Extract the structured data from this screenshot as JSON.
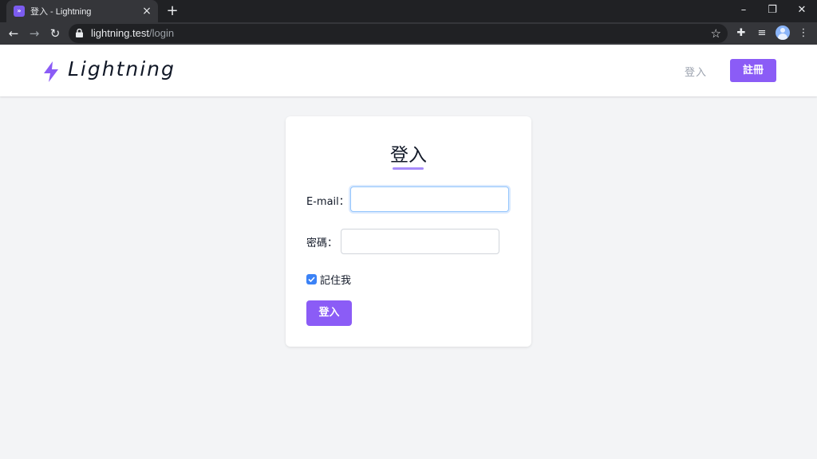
{
  "browser": {
    "tab_title": "登入 - Lightning",
    "favicon_text": "»",
    "url_host": "lightning.test",
    "url_path": "/login",
    "icons": [
      "back-icon",
      "forward-icon",
      "reload-icon",
      "lock-icon",
      "star-icon",
      "extensions-icon",
      "media-icon",
      "profile-icon",
      "menu-icon",
      "minimize-icon",
      "restore-icon",
      "close-icon"
    ]
  },
  "header": {
    "brand": "Lightning",
    "nav_login": "登入",
    "nav_register": "註冊"
  },
  "login_form": {
    "title": "登入",
    "email_label": "E-mail：",
    "email_value": "",
    "password_label": "密碼：",
    "password_value": "",
    "remember_label": "記住我",
    "remember_checked": true,
    "submit_label": "登入"
  },
  "colors": {
    "accent": "#8b5cf6",
    "accent_light": "#a78bfa",
    "checkbox": "#3b82f6",
    "page_bg": "#f3f4f6"
  }
}
